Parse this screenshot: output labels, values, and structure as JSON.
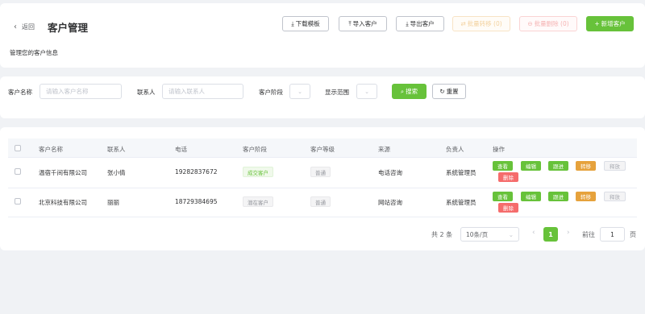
{
  "header": {
    "back_label": "返回",
    "title": "客户管理",
    "subtitle": "管理您的客户信息",
    "buttons": {
      "download_template": "下载模板",
      "import": "导入客户",
      "export": "导出客户",
      "batch_transfer": "批量转移 (0)",
      "batch_delete": "批量删除 (0)",
      "add": "新增客户"
    }
  },
  "filters": {
    "customer_name_label": "客户名称",
    "customer_name_placeholder": "请输入客户名称",
    "contact_label": "联系人",
    "contact_placeholder": "请输入联系人",
    "stage_label": "客户阶段",
    "scope_label": "显示范围",
    "search_label": "搜索",
    "reset_label": "重置"
  },
  "table": {
    "columns": [
      "客户名称",
      "联系人",
      "电话",
      "客户阶段",
      "客户等级",
      "来源",
      "负责人",
      "操作"
    ],
    "rows": [
      {
        "name": "温宿千间有限公司",
        "contact": "张小倩",
        "phone": "19282837672",
        "stage": "成交客户",
        "stage_type": "success",
        "level": "普通",
        "source": "电话咨询",
        "owner": "系统管理员"
      },
      {
        "name": "北京科技有限公司",
        "contact": "丽丽",
        "phone": "18729384695",
        "stage": "潜在客户",
        "stage_type": "info",
        "level": "普通",
        "source": "网站咨询",
        "owner": "系统管理员"
      }
    ],
    "actions": {
      "view": "查看",
      "edit": "编辑",
      "follow": "跟进",
      "transfer": "转移",
      "release": "释放",
      "delete": "删除"
    }
  },
  "pagination": {
    "total": "共 2 条",
    "page_size": "10条/页",
    "current_page": "1",
    "goto_label": "前往",
    "goto_value": "1",
    "page_suffix": "页"
  },
  "colors": {
    "primary": "#67c23a",
    "warning": "#e6a23c",
    "danger": "#f56c6c"
  }
}
